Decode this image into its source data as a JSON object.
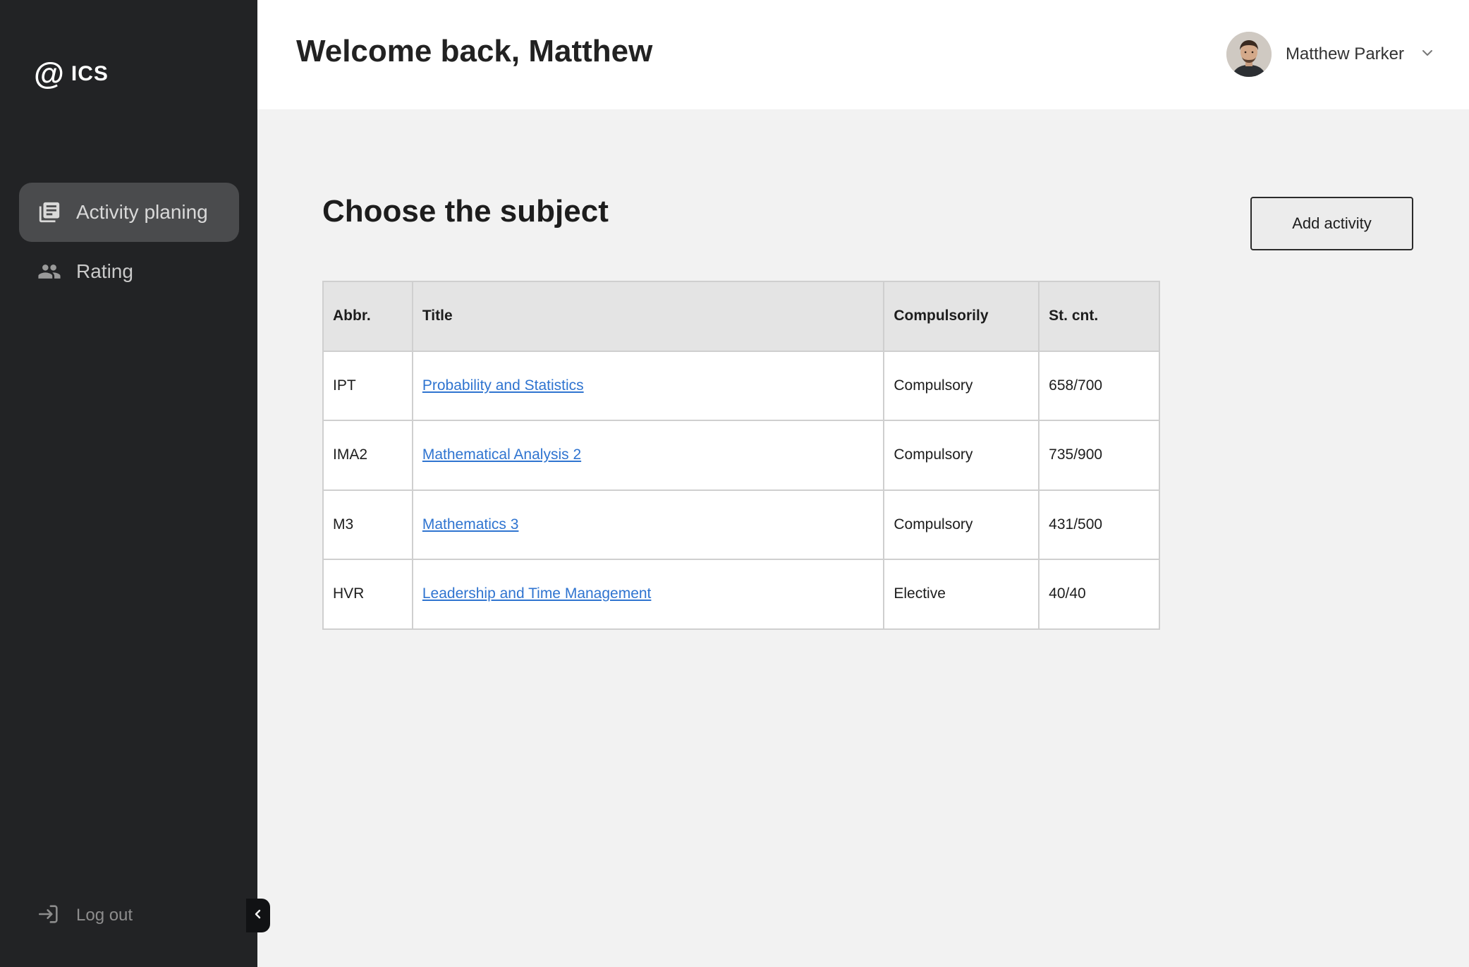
{
  "brand": {
    "mark": "@",
    "name": "ICS"
  },
  "sidebar": {
    "items": [
      {
        "label": "Activity planing",
        "icon": "list-doc-icon",
        "active": true
      },
      {
        "label": "Rating",
        "icon": "users-icon",
        "active": false
      }
    ],
    "logout_label": "Log out"
  },
  "header": {
    "welcome": "Welcome back, Matthew",
    "user_name": "Matthew Parker"
  },
  "main": {
    "title": "Choose the subject",
    "add_button": "Add activity",
    "table": {
      "headers": [
        "Abbr.",
        "Title",
        "Compulsorily",
        "St. cnt."
      ],
      "rows": [
        {
          "abbr": "IPT",
          "title": "Probability and Statistics",
          "type": "Compulsory",
          "count": "658/700"
        },
        {
          "abbr": "IMA2",
          "title": "Mathematical Analysis 2",
          "type": "Compulsory",
          "count": "735/900"
        },
        {
          "abbr": "M3",
          "title": "Mathematics 3",
          "type": "Compulsory",
          "count": "431/500"
        },
        {
          "abbr": "HVR",
          "title": "Leadership and Time Management",
          "type": "Elective",
          "count": "40/40"
        }
      ]
    }
  },
  "colors": {
    "sidebar_bg": "#222325",
    "active_item_bg": "#4a4b4d",
    "link": "#2f74d0",
    "page_bg": "#f2f2f2"
  }
}
